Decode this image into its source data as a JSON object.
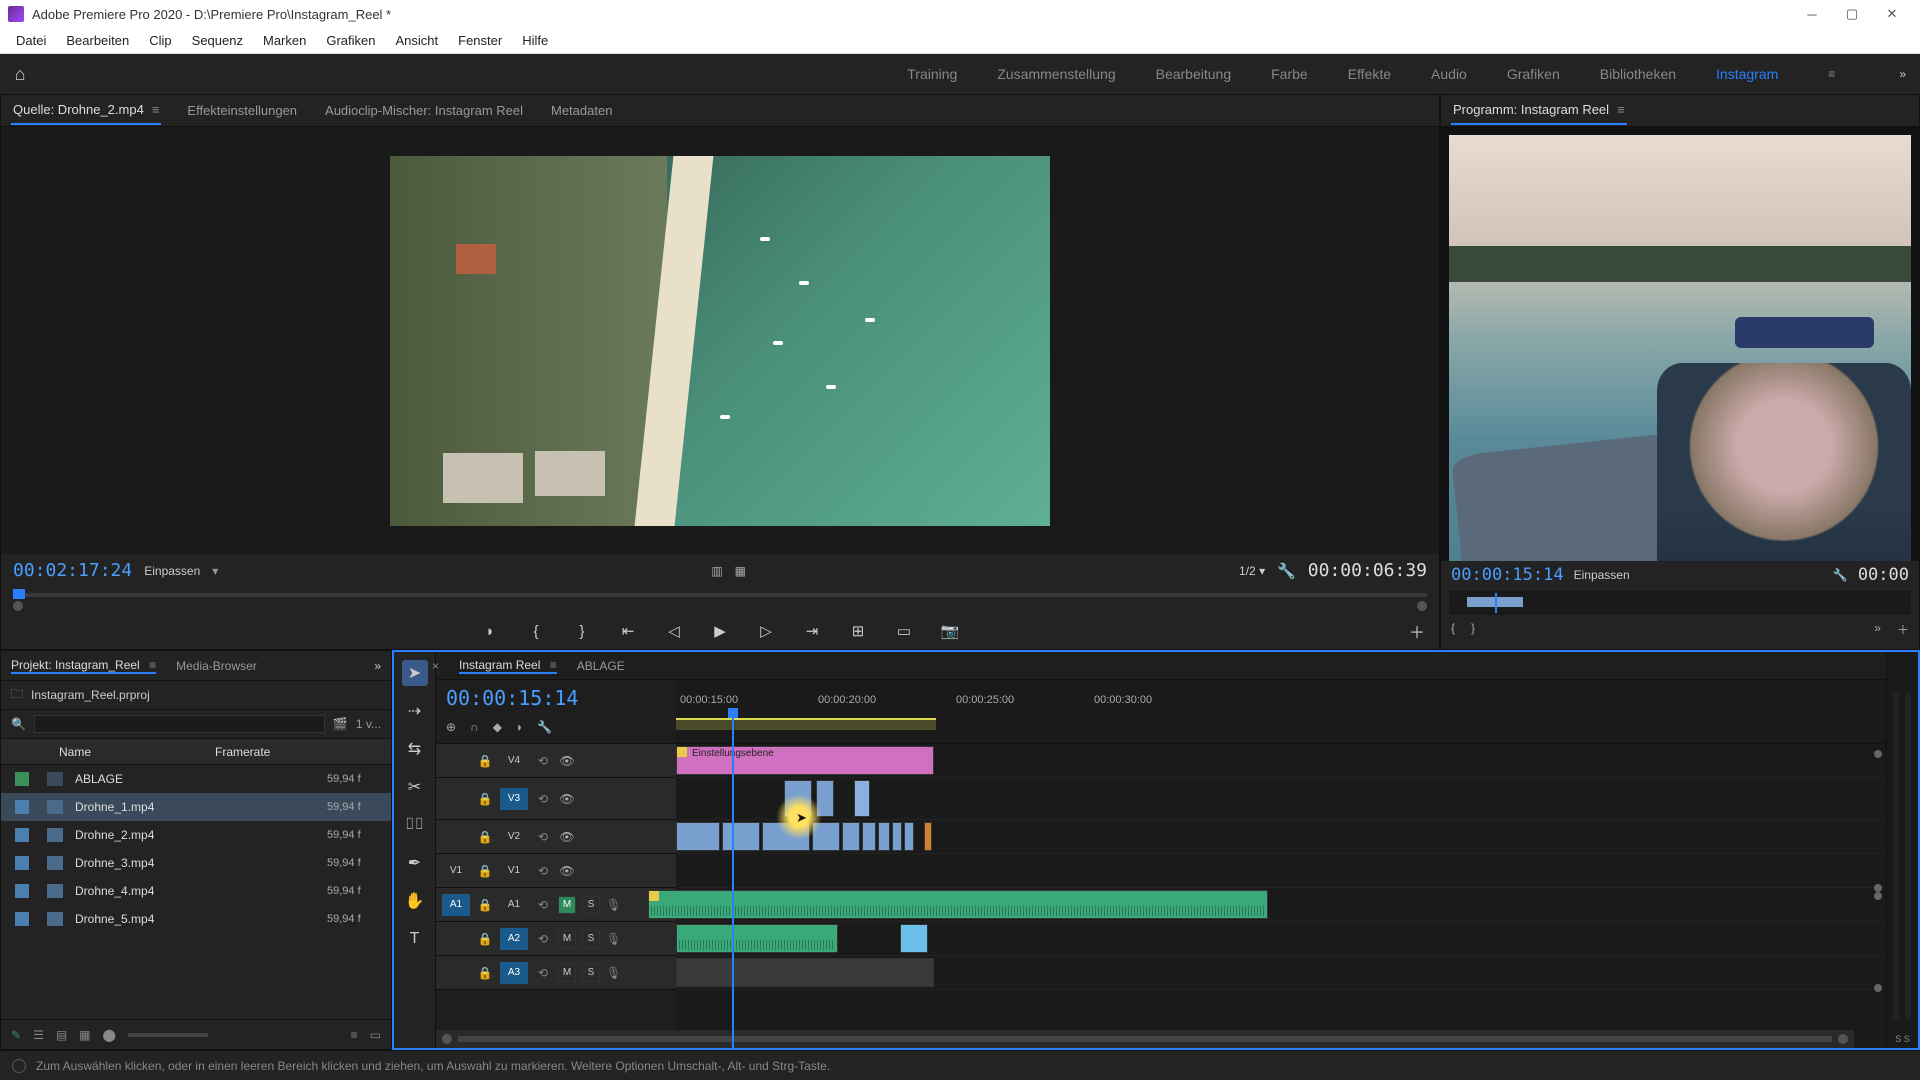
{
  "titlebar": {
    "text": "Adobe Premiere Pro 2020 - D:\\Premiere Pro\\Instagram_Reel *"
  },
  "menu": [
    "Datei",
    "Bearbeiten",
    "Clip",
    "Sequenz",
    "Marken",
    "Grafiken",
    "Ansicht",
    "Fenster",
    "Hilfe"
  ],
  "workspaces": {
    "items": [
      "Training",
      "Zusammenstellung",
      "Bearbeitung",
      "Farbe",
      "Effekte",
      "Audio",
      "Grafiken",
      "Bibliotheken",
      "Instagram"
    ],
    "active": "Instagram"
  },
  "source_tabs": {
    "items": [
      "Quelle: Drohne_2.mp4",
      "Effekteinstellungen",
      "Audioclip-Mischer: Instagram Reel",
      "Metadaten"
    ],
    "active_index": 0
  },
  "source_monitor": {
    "tc_left": "00:02:17:24",
    "fit": "Einpassen",
    "quality": "1/2",
    "tc_right": "00:00:06:39"
  },
  "program_tabs": {
    "label": "Programm: Instagram Reel"
  },
  "program_monitor": {
    "tc_left": "00:00:15:14",
    "fit": "Einpassen",
    "tc_right": "00:00"
  },
  "project": {
    "tab_project": "Projekt: Instagram_Reel",
    "tab_media": "Media-Browser",
    "breadcrumb": "Instagram_Reel.prproj",
    "view_count": "1 v...",
    "cols": {
      "name": "Name",
      "framerate": "Framerate"
    },
    "items": [
      {
        "name": "ABLAGE",
        "fps": "59,94 f",
        "type": "bin",
        "selected": false
      },
      {
        "name": "Drohne_1.mp4",
        "fps": "59,94 f",
        "type": "vid",
        "selected": true
      },
      {
        "name": "Drohne_2.mp4",
        "fps": "59,94 f",
        "type": "vid",
        "selected": false
      },
      {
        "name": "Drohne_3.mp4",
        "fps": "59,94 f",
        "type": "vid",
        "selected": false
      },
      {
        "name": "Drohne_4.mp4",
        "fps": "59,94 f",
        "type": "vid",
        "selected": false
      },
      {
        "name": "Drohne_5.mp4",
        "fps": "59,94 f",
        "type": "vid",
        "selected": false
      }
    ]
  },
  "timeline": {
    "tab_active": "Instagram Reel",
    "tab_other": "ABLAGE",
    "tc": "00:00:15:14",
    "ruler": [
      "00:00:15:00",
      "00:00:20:00",
      "00:00:25:00",
      "00:00:30:00"
    ],
    "adjustment_label": "Einstellungsebene",
    "tracks_v": [
      "V4",
      "V3",
      "V2",
      "V1"
    ],
    "tracks_a": [
      "A1",
      "A2",
      "A3"
    ],
    "btn_m": "M",
    "btn_s": "S",
    "meter_label": "S  S"
  },
  "status": {
    "text": "Zum Auswählen klicken, oder in einen leeren Bereich klicken und ziehen, um Auswahl zu markieren. Weitere Optionen Umschalt-, Alt- und Strg-Taste."
  }
}
